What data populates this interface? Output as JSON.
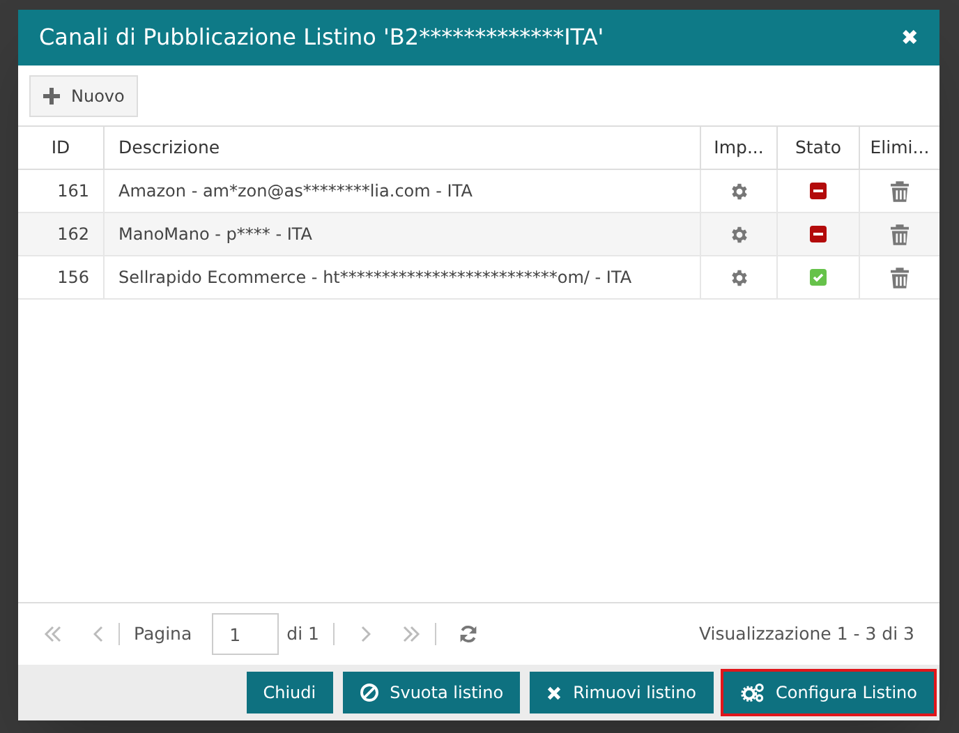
{
  "dialog": {
    "title": "Canali di Pubblicazione Listino 'B2*************ITA'",
    "close": "✖"
  },
  "toolbar": {
    "new_button": "Nuovo"
  },
  "table": {
    "columns": [
      "ID",
      "Descrizione",
      "Imp...",
      "Stato",
      "Elimi..."
    ],
    "rows": [
      {
        "id": "161",
        "description": "Amazon - am*zon@as********lia.com - ITA",
        "active": false
      },
      {
        "id": "162",
        "description": "ManoMano - p**** - ITA",
        "active": false
      },
      {
        "id": "156",
        "description": "Sellrapido Ecommerce - ht**************************om/ - ITA",
        "active": true
      }
    ]
  },
  "pager": {
    "page_label": "Pagina",
    "page": "1",
    "of": "di 1",
    "summary": "Visualizzazione 1 - 3 di 3"
  },
  "buttons": [
    {
      "label": "Chiudi",
      "kind": "plain",
      "highlighted": false
    },
    {
      "label": "Svuota listino",
      "kind": "ban",
      "highlighted": false
    },
    {
      "label": "Rimuovi listino",
      "kind": "cross",
      "highlighted": false
    },
    {
      "label": "Configura Listino",
      "kind": "gears",
      "highlighted": true
    }
  ]
}
